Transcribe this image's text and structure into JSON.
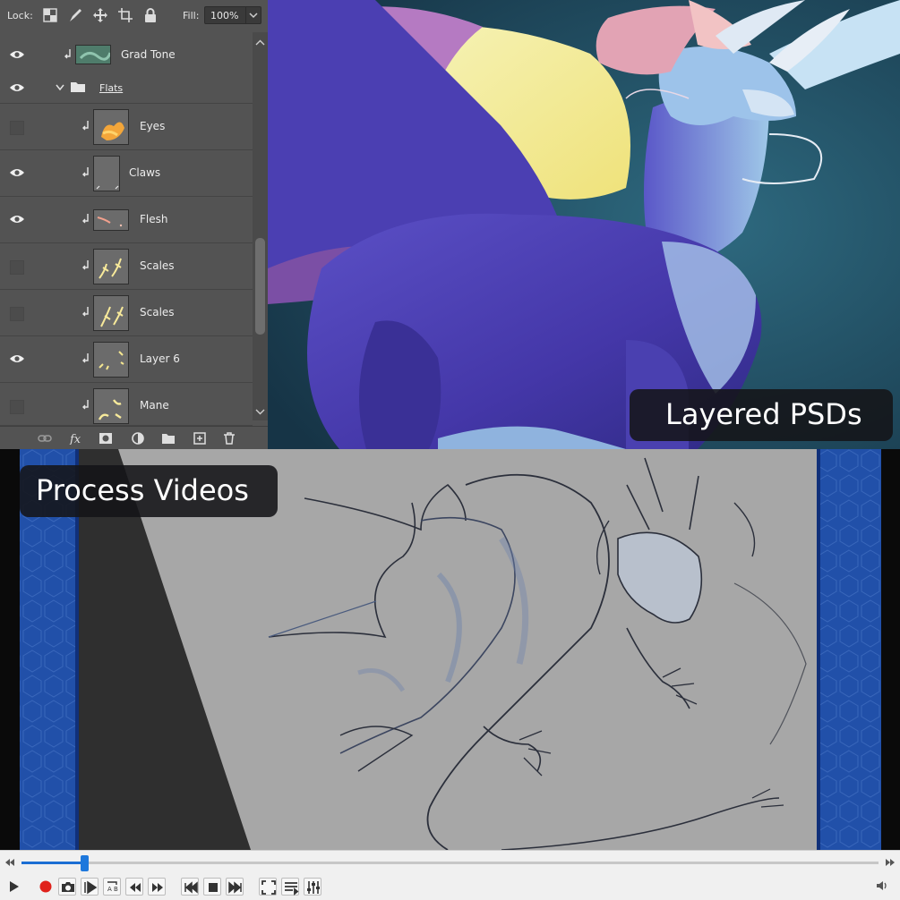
{
  "layers_panel": {
    "lock_label": "Lock:",
    "fill_label": "Fill:",
    "fill_value": "100%",
    "layers": [
      {
        "name": "Grad Tone",
        "visible": true,
        "clipped": true,
        "type": "layer"
      },
      {
        "name": "Flats",
        "visible": true,
        "clipped": false,
        "type": "group"
      },
      {
        "name": "Eyes",
        "visible": false,
        "clipped": true,
        "type": "layer"
      },
      {
        "name": "Claws",
        "visible": true,
        "clipped": true,
        "type": "layer"
      },
      {
        "name": "Flesh",
        "visible": true,
        "clipped": true,
        "type": "layer"
      },
      {
        "name": "Scales",
        "visible": false,
        "clipped": true,
        "type": "layer"
      },
      {
        "name": "Scales",
        "visible": false,
        "clipped": true,
        "type": "layer"
      },
      {
        "name": "Layer 6",
        "visible": true,
        "clipped": true,
        "type": "layer"
      },
      {
        "name": "Mane",
        "visible": false,
        "clipped": true,
        "type": "layer"
      }
    ],
    "footer_icons": [
      "link-icon",
      "fx-icon",
      "mask-icon",
      "adjustment-icon",
      "folder-icon",
      "new-layer-icon",
      "trash-icon"
    ]
  },
  "captions": {
    "top": "Layered PSDs",
    "bottom": "Process Videos"
  },
  "player": {
    "progress": 0.073,
    "buttons": [
      "play",
      "record",
      "snapshot",
      "frame-step",
      "loop-ab",
      "slower",
      "faster",
      "previous",
      "stop",
      "next",
      "fullscreen",
      "playlist",
      "extended-settings"
    ],
    "accent": "#1b6ed3",
    "record_color": "#e0211b"
  },
  "colors": {
    "panel_bg": "#535353",
    "art_bg": "#1f4a5e",
    "dragon_body": "#4f48b3",
    "honeycomb_blue": "#1f4ea8"
  }
}
